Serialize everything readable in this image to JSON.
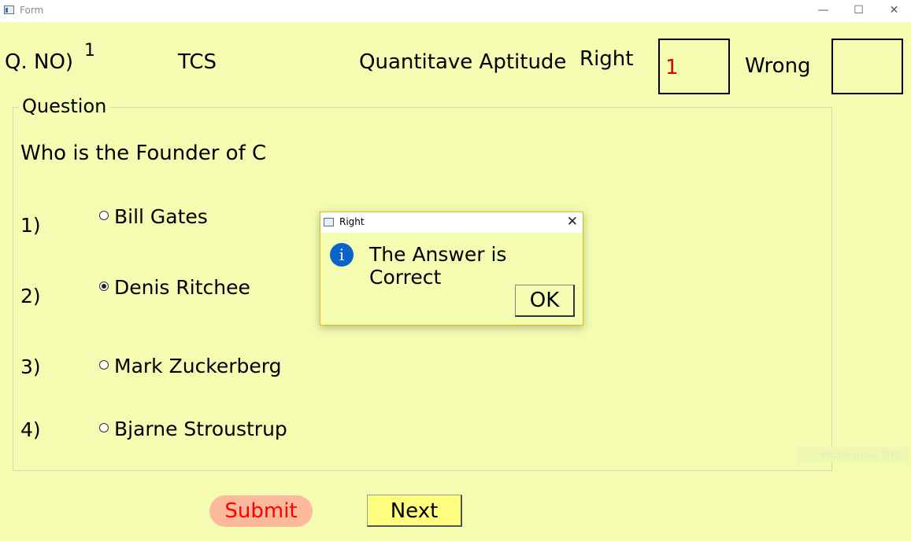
{
  "window": {
    "title": "Form",
    "minimize": "—",
    "maximize": "☐",
    "close": "✕"
  },
  "header": {
    "qno_label": "Q. NO)",
    "qno_value": "1",
    "company": "TCS",
    "category": "Quantitave Aptitude",
    "right_label": "Right",
    "right_value": "1",
    "wrong_label": "Wrong",
    "wrong_value": ""
  },
  "question": {
    "group_title": "Question",
    "text": "Who is the Founder of C",
    "options": [
      {
        "number": "1)",
        "label": "Bill Gates",
        "checked": false
      },
      {
        "number": "2)",
        "label": "Denis Ritchee",
        "checked": true
      },
      {
        "number": "3)",
        "label": "Mark Zuckerberg",
        "checked": false
      },
      {
        "number": "4)",
        "label": "Bjarne Stroustrup",
        "checked": false
      }
    ]
  },
  "buttons": {
    "submit": "Submit",
    "next": "Next"
  },
  "dialog": {
    "title": "Right",
    "close": "✕",
    "message": "The Answer is Correct",
    "ok": "OK",
    "icon": "i"
  },
  "overlay": {
    "snip_text": "Rectangular Snip"
  },
  "colors": {
    "background": "#f3fcb1",
    "right_value": "#e00000",
    "submit_text": "#ff0000",
    "submit_bg": "#fdb99c",
    "next_bg": "#ffff7f",
    "info_icon": "#0a63c9"
  }
}
